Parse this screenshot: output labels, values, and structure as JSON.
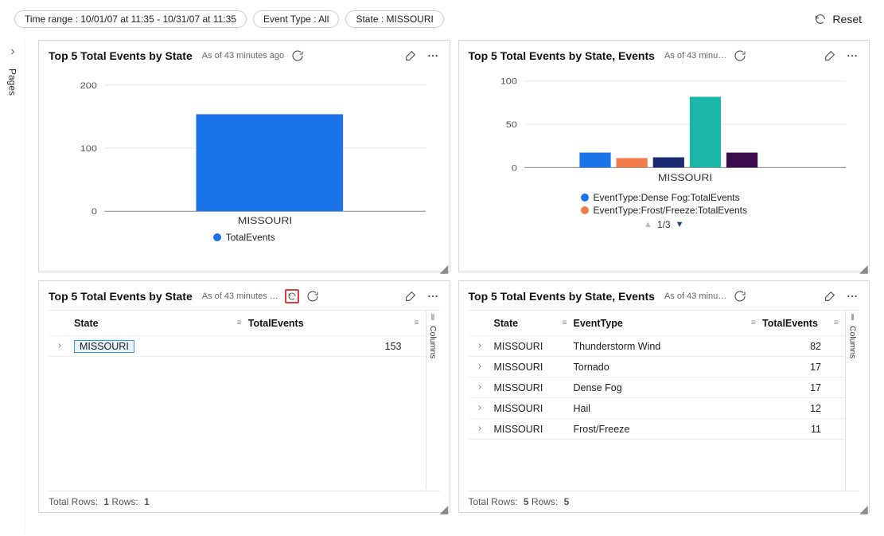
{
  "filters": {
    "time_range": "Time range : 10/01/07 at 11:35 - 10/31/07 at 11:35",
    "event_type": "Event Type : All",
    "state": "State : MISSOURI",
    "reset_label": "Reset"
  },
  "side": {
    "pages": "Pages"
  },
  "cards": {
    "c1": {
      "title": "Top 5 Total Events by State",
      "asof": "As of 43 minutes ago",
      "xlabel": "MISSOURI",
      "legend_label": "TotalEvents"
    },
    "c2": {
      "title": "Top 5 Total Events by State, Events",
      "asof": "As of 43 minu…",
      "xlabel": "MISSOURI",
      "legend_a": "EventType:Dense Fog:TotalEvents",
      "legend_b": "EventType:Frost/Freeze:TotalEvents",
      "pager": "1/3"
    },
    "c3": {
      "title": "Top 5 Total Events by State",
      "asof": "As of 43 minutes …",
      "col_state": "State",
      "col_total": "TotalEvents",
      "row0_state": "MISSOURI",
      "row0_total": "153",
      "footer_total_label": "Total Rows:",
      "footer_total": "1",
      "footer_rows_label": "Rows:",
      "footer_rows": "1",
      "rail": "Columns"
    },
    "c4": {
      "title": "Top 5 Total Events by State, Events",
      "asof": "As of 43 minu…",
      "col_state": "State",
      "col_event": "EventType",
      "col_total": "TotalEvents",
      "rows": [
        {
          "state": "MISSOURI",
          "event": "Thunderstorm Wind",
          "total": "82"
        },
        {
          "state": "MISSOURI",
          "event": "Tornado",
          "total": "17"
        },
        {
          "state": "MISSOURI",
          "event": "Dense Fog",
          "total": "17"
        },
        {
          "state": "MISSOURI",
          "event": "Hail",
          "total": "12"
        },
        {
          "state": "MISSOURI",
          "event": "Frost/Freeze",
          "total": "11"
        }
      ],
      "footer_total_label": "Total Rows:",
      "footer_total": "5",
      "footer_rows_label": "Rows:",
      "footer_rows": "5",
      "rail": "Columns"
    }
  },
  "chart_data": [
    {
      "type": "bar",
      "title": "Top 5 Total Events by State",
      "categories": [
        "MISSOURI"
      ],
      "series": [
        {
          "name": "TotalEvents",
          "values": [
            153
          ]
        }
      ],
      "ylim": [
        0,
        200
      ],
      "ylabel": "",
      "xlabel": ""
    },
    {
      "type": "bar",
      "title": "Top 5 Total Events by State, Events",
      "categories": [
        "MISSOURI"
      ],
      "series": [
        {
          "name": "Dense Fog",
          "values": [
            17
          ]
        },
        {
          "name": "Frost/Freeze",
          "values": [
            11
          ]
        },
        {
          "name": "Hail",
          "values": [
            12
          ]
        },
        {
          "name": "Thunderstorm Wind",
          "values": [
            82
          ]
        },
        {
          "name": "Tornado",
          "values": [
            17
          ]
        }
      ],
      "ylim": [
        0,
        100
      ],
      "ylabel": "",
      "xlabel": ""
    }
  ]
}
